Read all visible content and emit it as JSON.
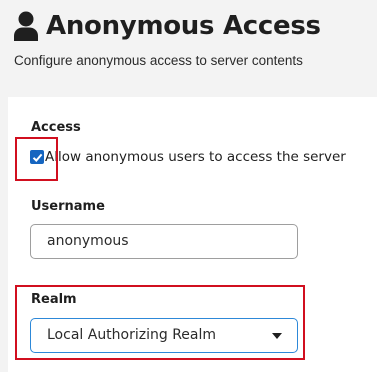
{
  "header": {
    "icon": "user-icon",
    "title": "Anonymous Access",
    "subtitle": "Configure anonymous access to server contents"
  },
  "form": {
    "access": {
      "label": "Access",
      "checkbox_label": "Allow anonymous users to access the server",
      "checked": true
    },
    "username": {
      "label": "Username",
      "value": "anonymous"
    },
    "realm": {
      "label": "Realm",
      "selected": "Local Authorizing Realm"
    }
  },
  "colors": {
    "accent": "#1565c0",
    "highlight": "#d10f1f",
    "focus_border": "#2d88d8"
  }
}
